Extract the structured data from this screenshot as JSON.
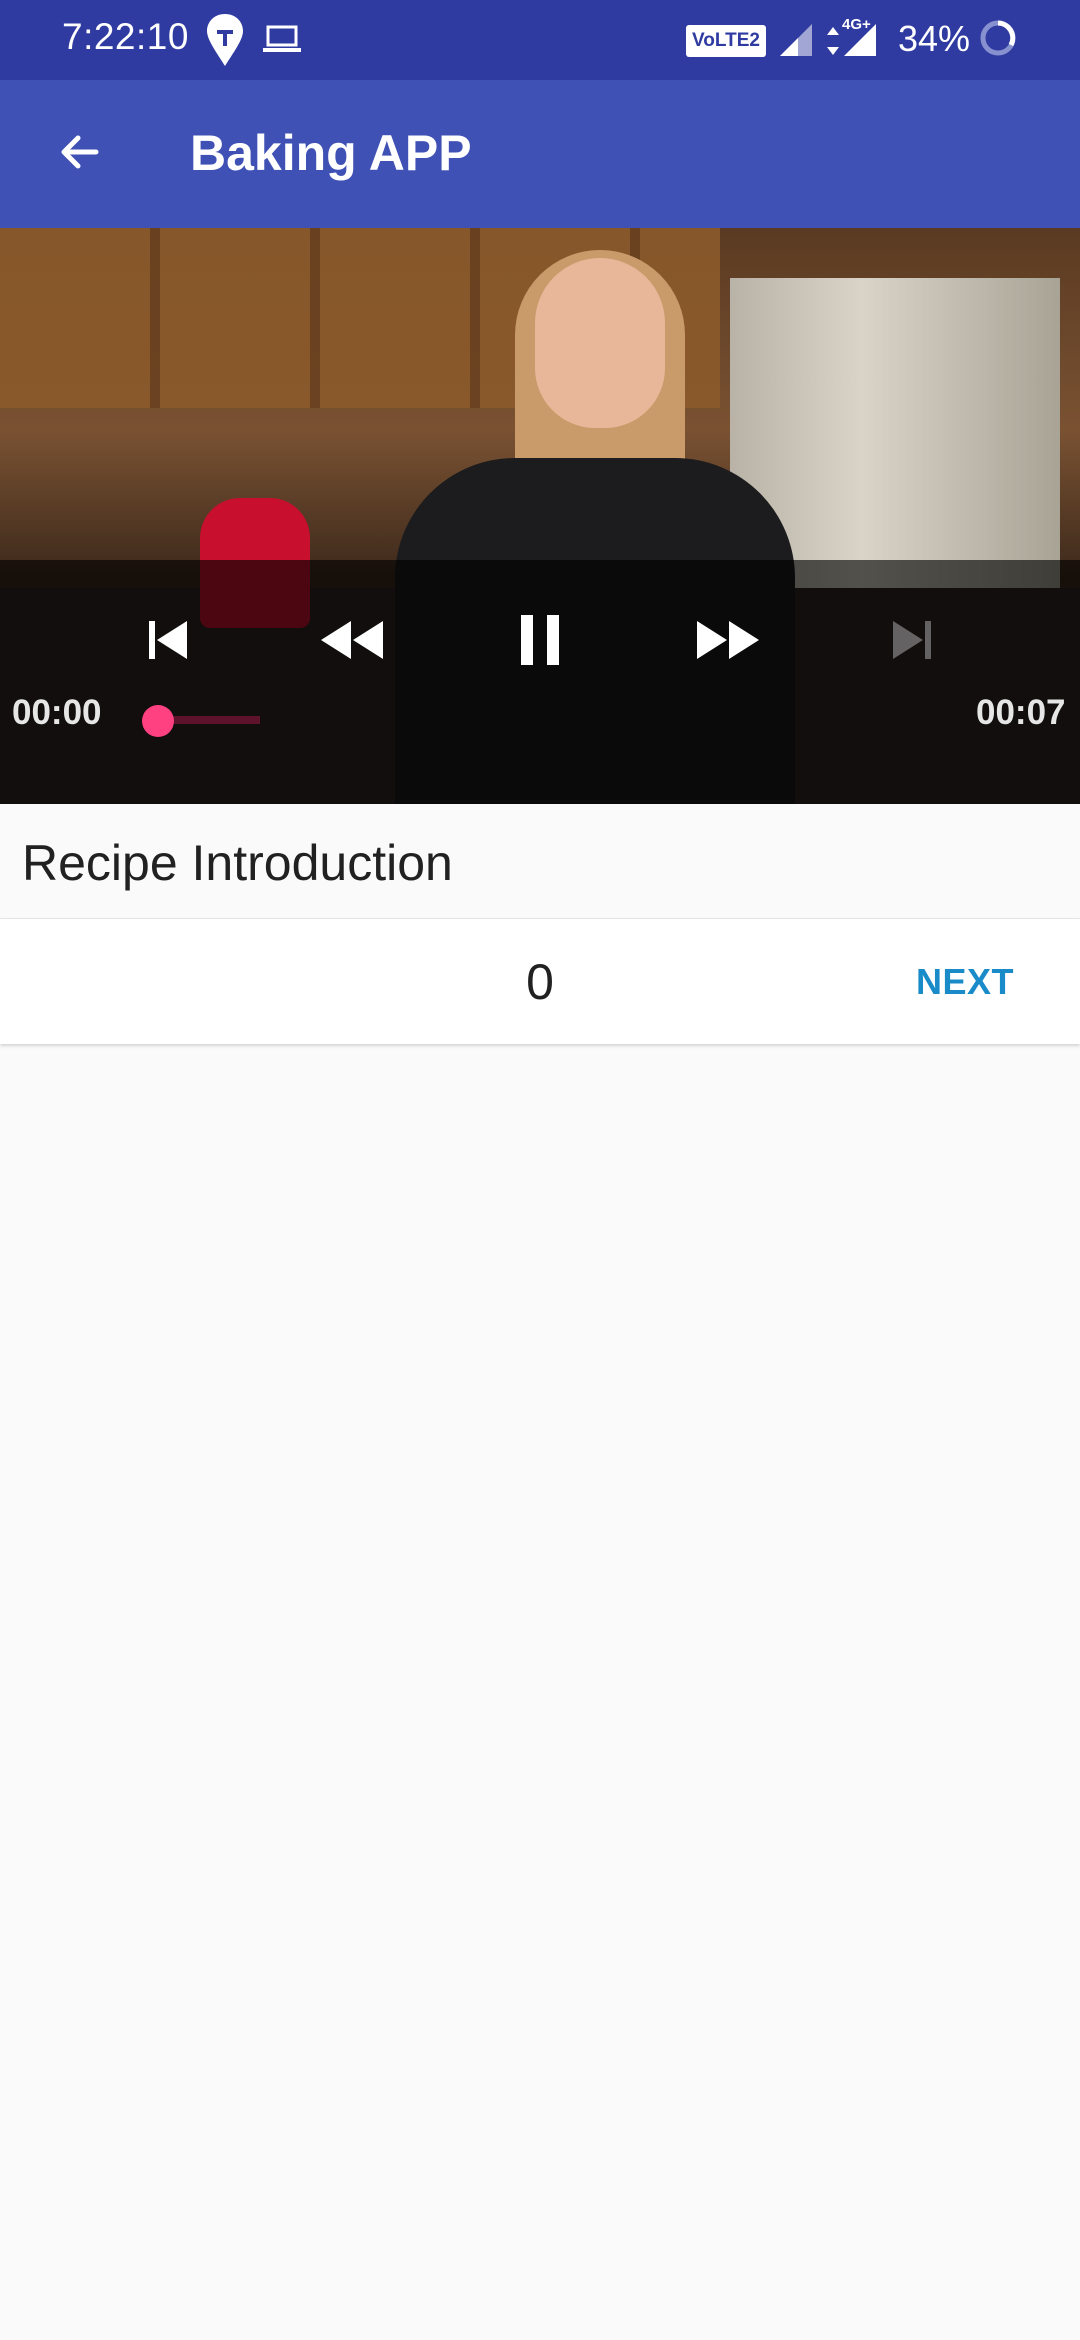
{
  "status_bar": {
    "time": "7:22:10",
    "volte_label": "VoLTE2",
    "network_label": "4G+",
    "battery": "34%"
  },
  "app_bar": {
    "title": "Baking APP"
  },
  "player": {
    "position": "00:00",
    "duration": "00:07"
  },
  "step": {
    "title": "Recipe Introduction",
    "index": "0",
    "next_label": "NEXT"
  },
  "colors": {
    "status_bar": "#2f3ba1",
    "app_bar": "#3f51b5",
    "accent": "#ff4081",
    "next": "#1a8bc9"
  },
  "icons": {
    "back": "arrow-left-icon",
    "previous": "skip-previous-icon",
    "rewind": "rewind-icon",
    "pause": "pause-icon",
    "fast_forward": "fast-forward-icon",
    "next": "skip-next-icon"
  }
}
